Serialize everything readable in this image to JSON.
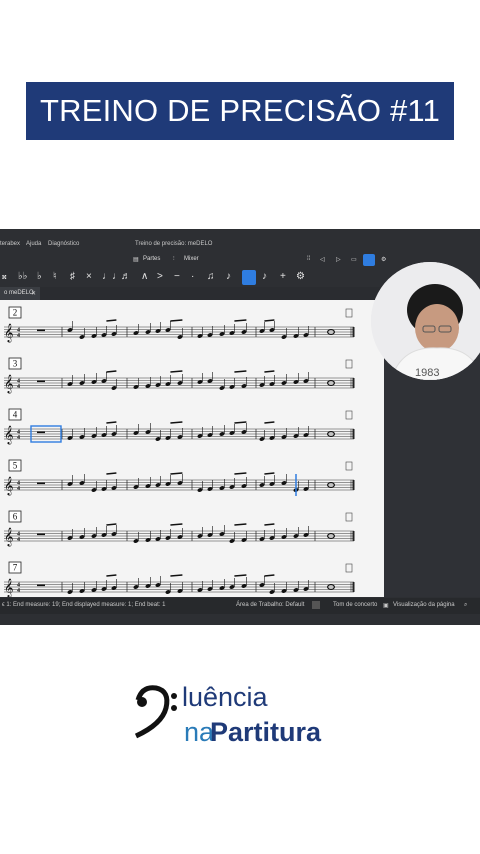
{
  "banner": {
    "title": "TREINO DE PRECISÃO #11"
  },
  "app": {
    "menu": [
      "terabex",
      "Ajuda",
      "Diagnóstico"
    ],
    "window_title": "Treino de precisão: meDELO",
    "toolbar1": {
      "parts_label": "Partes",
      "mixer_label": "Mixer"
    },
    "tab": {
      "label": "o meDELO",
      "close": "✕"
    },
    "measures": [
      "2",
      "3",
      "4",
      "5",
      "6",
      "7"
    ],
    "time_signature": {
      "top": "4",
      "bottom": "4"
    },
    "status": {
      "left": "ϵ 1: End measure: 19; End displayed measure: 1; End beat: 1",
      "workspace": "Área de Trabalho: Default",
      "concert": "Tom de concerto",
      "view": "Visualização da página"
    }
  },
  "logo": {
    "line1": "luência",
    "line2a": "na",
    "line2b": "Partitura"
  }
}
